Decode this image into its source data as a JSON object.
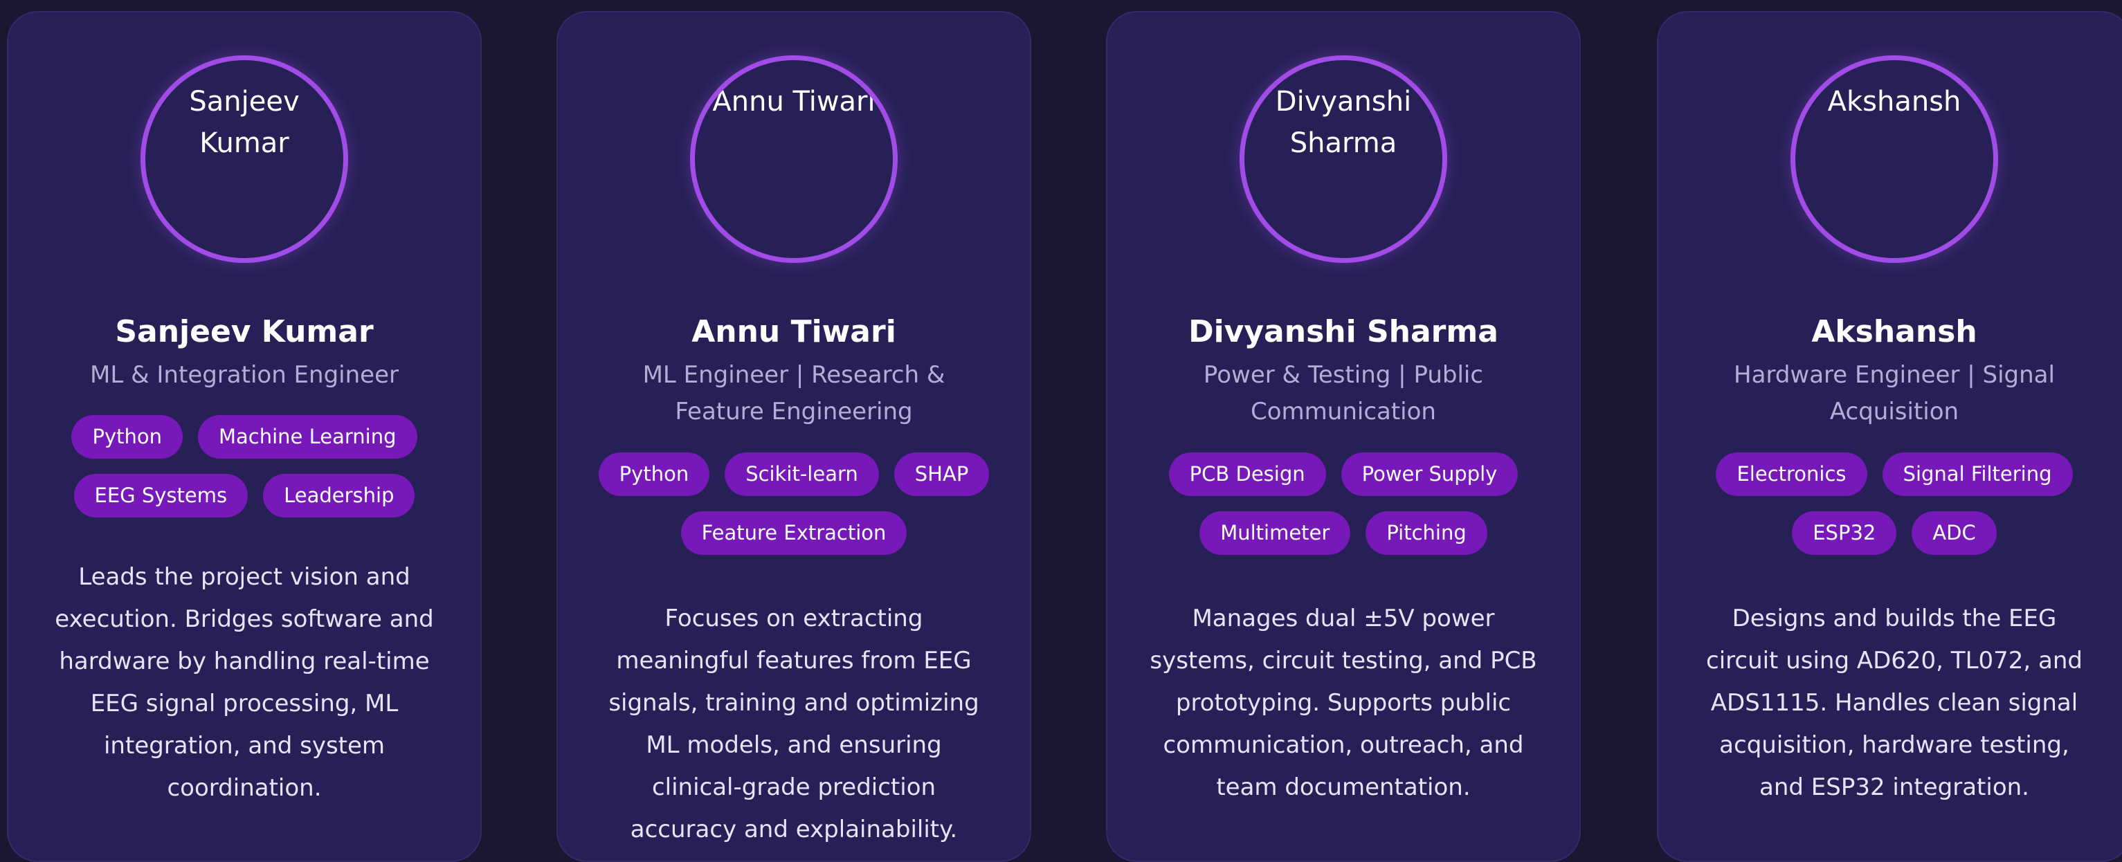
{
  "members": [
    {
      "avatar_alt": "Sanjeev Kumar",
      "name": "Sanjeev Kumar",
      "role": "ML & Integration Engineer",
      "skills": [
        "Python",
        "Machine Learning",
        "EEG Systems",
        "Leadership"
      ],
      "bio": "Leads the project vision and execution. Bridges software and hardware by handling real-time EEG signal processing, ML integration, and system coordination."
    },
    {
      "avatar_alt": "Annu Tiwari",
      "name": "Annu Tiwari",
      "role": "ML Engineer | Research & Feature Engineering",
      "skills": [
        "Python",
        "Scikit-learn",
        "SHAP",
        "Feature Extraction"
      ],
      "bio": "Focuses on extracting meaningful features from EEG signals, training and optimizing ML models, and ensuring clinical-grade prediction accuracy and explainability."
    },
    {
      "avatar_alt": "Divyanshi Sharma",
      "name": "Divyanshi Sharma",
      "role": "Power & Testing | Public Communication",
      "skills": [
        "PCB Design",
        "Power Supply",
        "Multimeter",
        "Pitching"
      ],
      "bio": "Manages dual ±5V power systems, circuit testing, and PCB prototyping. Supports public communication, outreach, and team documentation."
    },
    {
      "avatar_alt": "Akshansh",
      "name": "Akshansh",
      "role": "Hardware Engineer | Signal Acquisition",
      "skills": [
        "Electronics",
        "Signal Filtering",
        "ESP32",
        "ADC"
      ],
      "bio": "Designs and builds the EEG circuit using AD620, TL072, and ADS1115. Handles clean signal acquisition, hardware testing, and ESP32 integration."
    }
  ],
  "colors": {
    "background": "#1b1733",
    "card": "#262056",
    "accent": "#a24ce8",
    "chip": "#7718b8",
    "role_text": "#b6acd8"
  }
}
